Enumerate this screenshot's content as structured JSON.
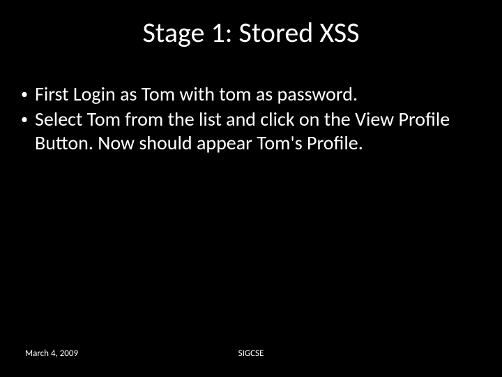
{
  "title": "Stage 1: Stored XSS",
  "bullets": [
    "First Login as Tom with tom as password.",
    "Select Tom from the list and click on the View Profile Button. Now should appear Tom's Profile."
  ],
  "footer": {
    "date": "March 4, 2009",
    "venue": "SIGCSE"
  }
}
